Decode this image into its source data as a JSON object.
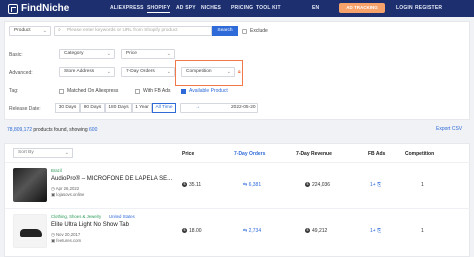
{
  "header": {
    "brand": "FindNiche",
    "nav": [
      "ALIEXPRESS",
      "SHOPIFY",
      "AD SPY",
      "NICHES",
      "PRICING",
      "TOOL KIT"
    ],
    "language": "EN",
    "cta": "AD TRACKING",
    "login": "LOGIN",
    "register": "REGISTER"
  },
  "search": {
    "scope": "Product",
    "placeholder": "Please enter keywords or URL from Shopify product",
    "button": "Search",
    "exclude": "Exclude"
  },
  "filters": {
    "basic_label": "Basic:",
    "category": "Category",
    "price": "Price",
    "advanced_label": "Advanced:",
    "store_address": "Store Address",
    "seven_day_orders": "7-Day Orders",
    "competition": "Competition",
    "tag_label": "Tag:",
    "tags": [
      {
        "label": "Matched On Aliexpress",
        "checked": false
      },
      {
        "label": "With FB Ads",
        "checked": false
      },
      {
        "label": "Available Product",
        "checked": true
      }
    ],
    "release_label": "Release Date:",
    "ranges": [
      "30 Days",
      "90 Days",
      "180 Days",
      "1 Year",
      "All Time"
    ],
    "active_range": "All Time",
    "date_from": "",
    "date_arrow": "→",
    "date_to": "2022-05-20"
  },
  "results": {
    "count": "78,809,172",
    "text_mid": "products found, showing",
    "shown": "600",
    "export": "Export CSV"
  },
  "table": {
    "sort_placeholder": "Sort By",
    "headers": [
      "Price",
      "7-Day Orders",
      "7-Day Revenue",
      "FB Ads",
      "Competition"
    ],
    "rows": [
      {
        "tags": [
          "Brazil"
        ],
        "title": "AudioPro® – MICROFONE DE LAPELA SE...",
        "date": "Apr 26,2022",
        "store": "lojasovs.online",
        "price": "35.11",
        "orders": "6,381",
        "revenue": "224,036",
        "fb_ads": "1+",
        "competition": "1"
      },
      {
        "tags": [
          "Clothing, Shoes & Jewelry",
          "United States"
        ],
        "title": "Elite Ultra Light No Show Tab",
        "date": "Nov 20,2017",
        "store": "feetures.com",
        "price": "18.00",
        "orders": "2,734",
        "revenue": "49,212",
        "fb_ads": "1+",
        "competition": "1"
      }
    ]
  },
  "colors": {
    "nav_bg": "#1d2f6f",
    "accent": "#2f6bd8",
    "cta": "#f7a26a",
    "highlight": "#f0784a"
  }
}
